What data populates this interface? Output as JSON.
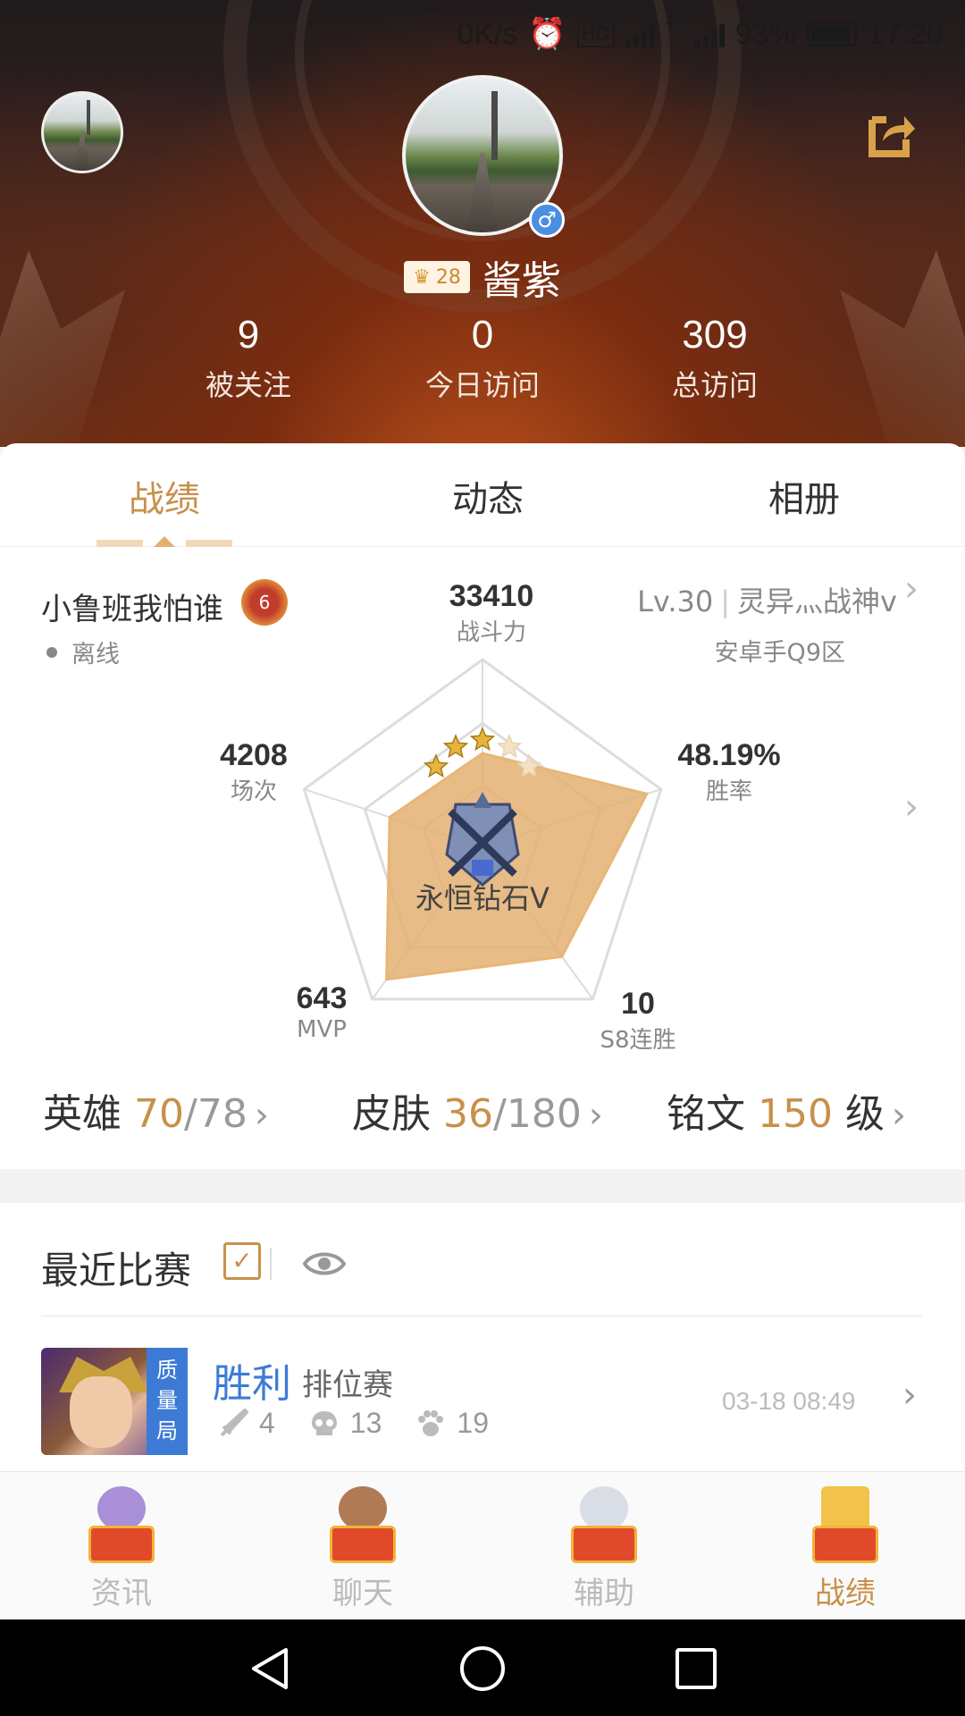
{
  "status_bar": {
    "speed": "0K/s",
    "network": "2G",
    "battery": "93%",
    "time": "17:20"
  },
  "profile": {
    "vip_level": "28",
    "nickname": "酱紫",
    "stats": [
      {
        "value": "9",
        "label": "被关注"
      },
      {
        "value": "0",
        "label": "今日访问"
      },
      {
        "value": "309",
        "label": "总访问"
      }
    ]
  },
  "tabs": [
    {
      "label": "战绩",
      "active": true
    },
    {
      "label": "动态",
      "active": false
    },
    {
      "label": "相册",
      "active": false
    }
  ],
  "player": {
    "game_name": "小鲁班我怕谁",
    "badge_number": "6",
    "status": "离线",
    "level": "Lv.30",
    "title": "灵异灬战神v",
    "server": "安卓手Q9区"
  },
  "radar": {
    "power": {
      "value": "33410",
      "label": "战斗力"
    },
    "matches": {
      "value": "4208",
      "label": "场次"
    },
    "win_rate": {
      "value": "48.19%",
      "label": "胜率"
    },
    "mvp": {
      "value": "643",
      "label": "MVP"
    },
    "streak": {
      "value": "10",
      "label": "S8连胜"
    },
    "rank_name": "永恒钻石V",
    "stars_filled": 3,
    "stars_total": 5,
    "shape_fraction": [
      0.5,
      0.92,
      0.72,
      0.87,
      0.52
    ],
    "accent_color": "#e3b071"
  },
  "summary": {
    "heroes": {
      "label": "英雄",
      "owned": "70",
      "total": "78"
    },
    "skins": {
      "label": "皮肤",
      "owned": "36",
      "total": "180"
    },
    "runes": {
      "label": "铭文",
      "value": "150",
      "unit": "级"
    }
  },
  "recent": {
    "title": "最近比赛",
    "check": "✓",
    "matches": [
      {
        "tag": [
          "质",
          "量",
          "局"
        ],
        "result": "胜利",
        "mode": "排位赛",
        "kills": "4",
        "deaths": "13",
        "assists": "19",
        "time": "03-18 08:49"
      }
    ]
  },
  "bottom_nav": [
    {
      "label": "资讯",
      "active": false,
      "icon": "news-mascot-icon"
    },
    {
      "label": "聊天",
      "active": false,
      "icon": "chat-mascot-icon"
    },
    {
      "label": "辅助",
      "active": false,
      "icon": "assist-mascot-icon"
    },
    {
      "label": "战绩",
      "active": true,
      "icon": "record-mascot-icon"
    }
  ],
  "colors": {
    "accent": "#c8904a",
    "win_blue": "#3d7ad6"
  }
}
